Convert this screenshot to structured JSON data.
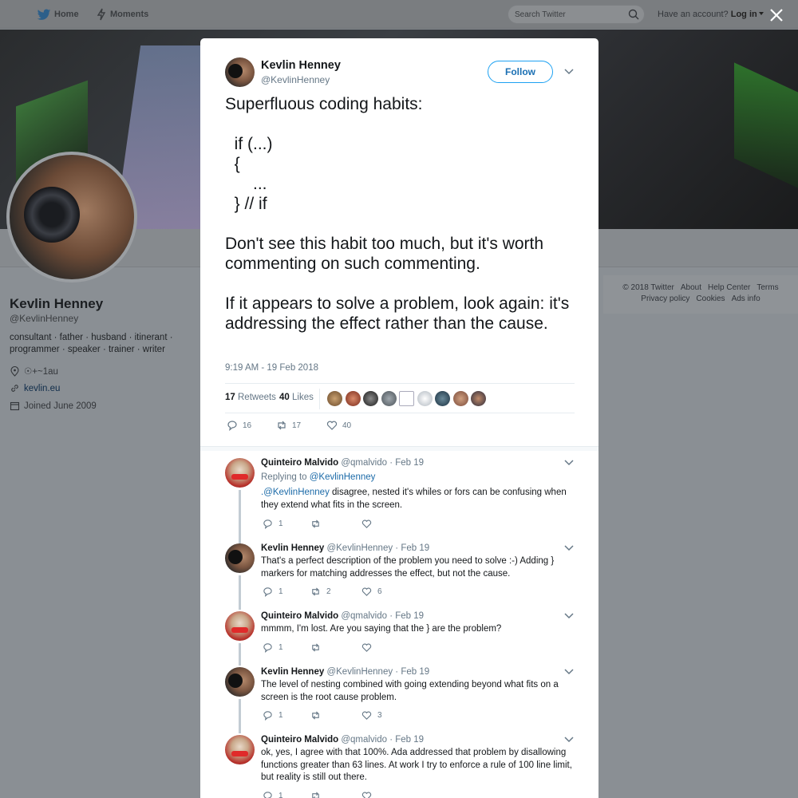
{
  "nav": {
    "home_label": "Home",
    "moments_label": "Moments",
    "search_placeholder": "Search Twitter",
    "have_account": "Have an account?",
    "login_label": "Log in"
  },
  "profile": {
    "name": "Kevlin Henney",
    "handle": "@KevlinHenney",
    "bio": "consultant · father · husband · itinerant · programmer · speaker · trainer · writer",
    "location": "☉+~1au",
    "website": "kevlin.eu",
    "joined": "Joined June 2009"
  },
  "footer": {
    "links": [
      "© 2018 Twitter",
      "About",
      "Help Center",
      "Terms",
      "Privacy policy",
      "Cookies",
      "Ads info"
    ]
  },
  "tweet": {
    "author_name": "Kevlin Henney",
    "author_handle": "@KevlinHenney",
    "follow_label": "Follow",
    "text": "Superfluous coding habits:\n\n  if (...)\n  {\n      ...\n  } // if\n\nDon't see this habit too much, but it's worth commenting on such commenting.\n\nIf it appears to solve a problem, look again: it's addressing the effect rather than the cause.",
    "timestamp": "9:19 AM - 19 Feb 2018",
    "retweets_count": "17",
    "retweets_label": "Retweets",
    "likes_count": "40",
    "likes_label": "Likes",
    "reply_count": "16",
    "retweet_action_count": "17",
    "like_action_count": "40"
  },
  "replies": [
    {
      "name": "Quinteiro Malvido",
      "handle": "@qmalvido",
      "date": "Feb 19",
      "replying_to_prefix": "Replying to",
      "replying_to": "@KevlinHenney",
      "mention": ".@KevlinHenney",
      "text": " disagree, nested it's whiles or fors can be confusing when they extend what fits in the screen.",
      "reply_count": "1",
      "retweet_count": "",
      "like_count": ""
    },
    {
      "name": "Kevlin Henney",
      "handle": "@KevlinHenney",
      "date": "Feb 19",
      "text": "That's a perfect description of the problem you need to solve :-) Adding } markers for matching addresses the effect, but not the cause.",
      "reply_count": "1",
      "retweet_count": "2",
      "like_count": "6"
    },
    {
      "name": "Quinteiro Malvido",
      "handle": "@qmalvido",
      "date": "Feb 19",
      "text": "mmmm, I'm lost. Are you saying that the } are the problem?",
      "reply_count": "1",
      "retweet_count": "",
      "like_count": ""
    },
    {
      "name": "Kevlin Henney",
      "handle": "@KevlinHenney",
      "date": "Feb 19",
      "text": "The level of nesting combined with going extending beyond what fits on a screen is the root cause problem.",
      "reply_count": "1",
      "retweet_count": "",
      "like_count": "3"
    },
    {
      "name": "Quinteiro Malvido",
      "handle": "@qmalvido",
      "date": "Feb 19",
      "text": "ok, yes, I agree with that 100%. Ada addressed that problem by disallowing functions greater than 63 lines. At work I try to enforce a rule of 100 line limit, but reality is still out there.",
      "reply_count": "1",
      "retweet_count": "",
      "like_count": ""
    }
  ],
  "colors": {
    "accent": "#1da1f2",
    "overlay": "#8a8f94",
    "secondary_text": "#657786"
  }
}
